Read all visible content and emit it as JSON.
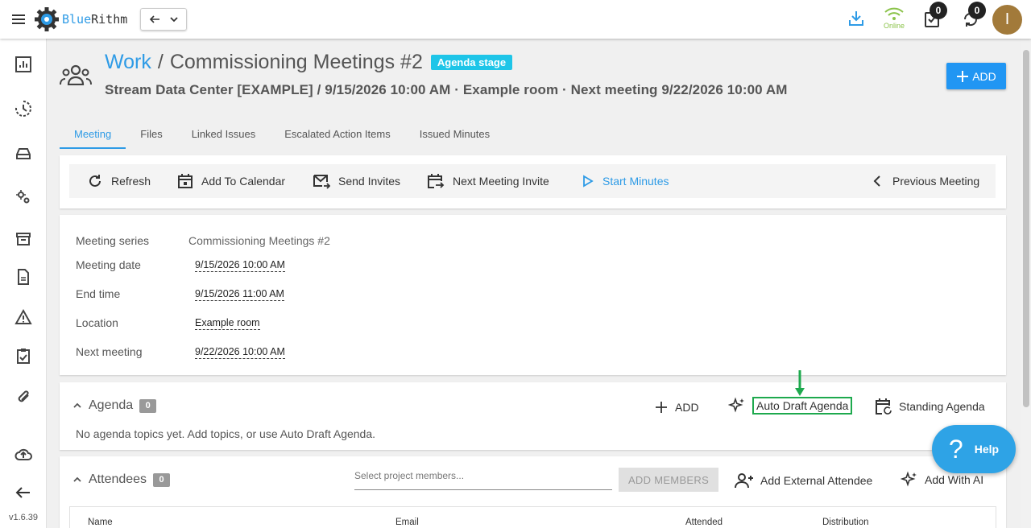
{
  "app": {
    "logo_blue": "Blue",
    "logo_dark": "Rithm",
    "version": "v1.6.39"
  },
  "topbar": {
    "status_label": "Online",
    "tasks_count": "0",
    "sync_count": "0",
    "avatar_initial": "I"
  },
  "header": {
    "breadcrumb_root": "Work",
    "separator": "/",
    "title": "Commissioning Meetings #2",
    "stage_badge": "Agenda stage",
    "subtitle": "Stream Data Center [EXAMPLE] / 9/15/2026 10:00 AM · Example room · Next meeting 9/22/2026 10:00 AM",
    "add_label": "ADD"
  },
  "tabs": [
    {
      "label": "Meeting",
      "active": true
    },
    {
      "label": "Files",
      "active": false
    },
    {
      "label": "Linked Issues",
      "active": false
    },
    {
      "label": "Escalated Action Items",
      "active": false
    },
    {
      "label": "Issued Minutes",
      "active": false
    }
  ],
  "toolbar": {
    "refresh": "Refresh",
    "add_to_calendar": "Add To Calendar",
    "send_invites": "Send Invites",
    "next_meeting_invite": "Next Meeting Invite",
    "start_minutes": "Start Minutes",
    "previous_meeting": "Previous Meeting"
  },
  "details": {
    "series_label": "Meeting series",
    "series_value": "Commissioning Meetings #2",
    "date_label": "Meeting date",
    "date_value": "9/15/2026 10:00 AM",
    "end_label": "End time",
    "end_value": "9/15/2026 11:00 AM",
    "location_label": "Location",
    "location_value": "Example room",
    "next_label": "Next meeting",
    "next_value": "9/22/2026 10:00 AM"
  },
  "agenda": {
    "title": "Agenda",
    "count": "0",
    "add": "ADD",
    "auto_draft": "Auto Draft Agenda",
    "standing": "Standing Agenda",
    "empty_text": "No agenda topics yet. Add topics, or use Auto Draft Agenda."
  },
  "attendees": {
    "title": "Attendees",
    "count": "0",
    "select_placeholder": "Select project members...",
    "add_members": "ADD MEMBERS",
    "add_external": "Add External Attendee",
    "add_ai": "Add With AI",
    "columns": [
      "Name",
      "Email",
      "Attended",
      "Distribution"
    ]
  },
  "help": {
    "label": "Help",
    "glyph": "?"
  },
  "colors": {
    "accent": "#2196f3",
    "link_blue": "#2e9be6",
    "stage_badge": "#1ec5e8",
    "online_green": "#8bc34a",
    "highlight_green": "#1ea94e"
  }
}
